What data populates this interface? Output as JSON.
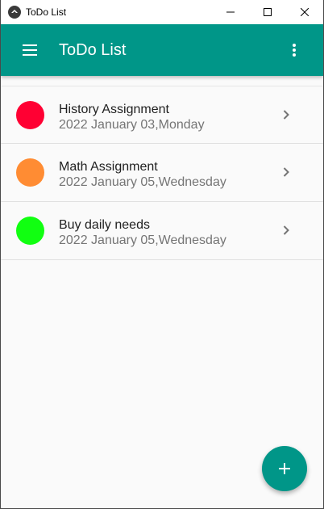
{
  "window": {
    "title": "ToDo List",
    "icon": "kivy-logo-icon",
    "controls": [
      "minimize-icon",
      "maximize-icon",
      "close-icon"
    ]
  },
  "appbar": {
    "title": "ToDo List",
    "background": "#009688",
    "left_icon": "menu-icon",
    "right_icon": "more-vert-icon"
  },
  "tasks": [
    {
      "title": "History Assignment",
      "date": "2022 January 03,Monday",
      "color": "#ff0033"
    },
    {
      "title": "Math Assignment",
      "date": "2022 January 05,Wednesday",
      "color": "#ff8c33"
    },
    {
      "title": "Buy daily needs",
      "date": "2022 January 05,Wednesday",
      "color": "#11ff11"
    }
  ],
  "fab": {
    "icon": "plus-icon",
    "color": "#009688"
  }
}
